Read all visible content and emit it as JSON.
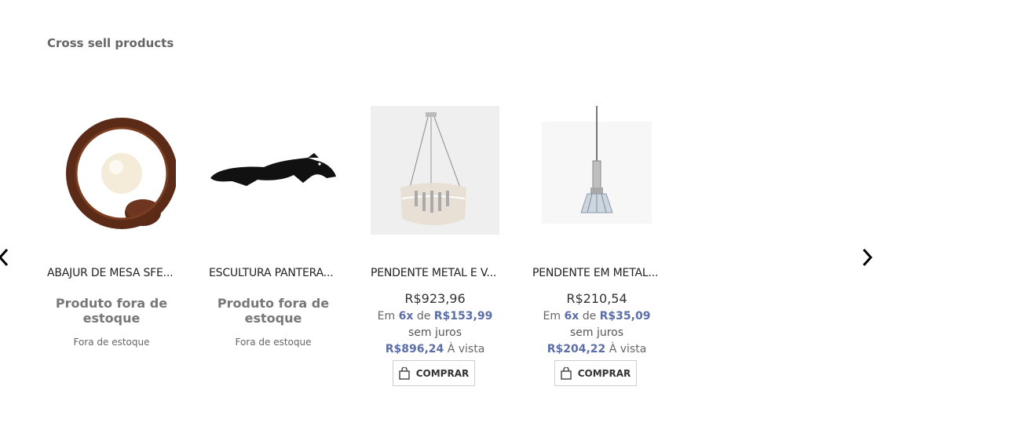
{
  "section": {
    "title": "Cross sell products"
  },
  "nav": {
    "prev_icon": "chevron-left-icon",
    "next_icon": "chevron-right-icon"
  },
  "products": [
    {
      "name": "ABAJUR DE MESA SFE...",
      "oos_title": "Produto fora de estoque",
      "oos_sub": "Fora de estoque"
    },
    {
      "name": "ESCULTURA PANTERA...",
      "oos_title": "Produto fora de estoque",
      "oos_sub": "Fora de estoque"
    },
    {
      "name": "PENDENTE METAL E V...",
      "price": "R$923,96",
      "inst_prefix": "Em",
      "inst_count": "6x",
      "inst_mid": "de",
      "inst_value": "R$153,99",
      "interest": "sem juros",
      "cash_value": "R$896,24",
      "cash_label": "À vista",
      "buy_label": "COMPRAR"
    },
    {
      "name": "PENDENTE EM METAL...",
      "price": "R$210,54",
      "inst_prefix": "Em",
      "inst_count": "6x",
      "inst_mid": "de",
      "inst_value": "R$35,09",
      "interest": "sem juros",
      "cash_value": "R$204,22",
      "cash_label": "À vista",
      "buy_label": "COMPRAR"
    }
  ],
  "colors": {
    "accent": "#5b6ea8",
    "title": "#666666"
  }
}
